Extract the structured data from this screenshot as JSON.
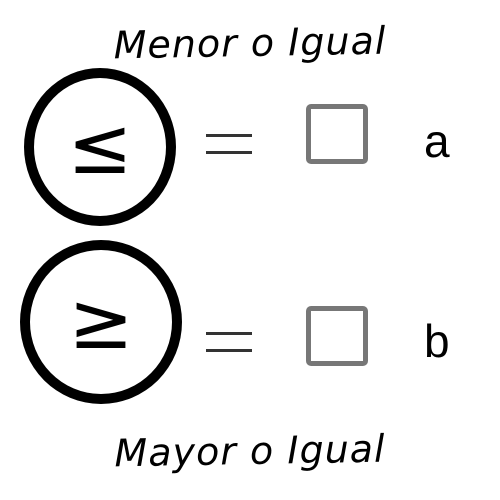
{
  "top_caption": "Menor o Igual",
  "bottom_caption": "Mayor o Igual",
  "rows": [
    {
      "symbol": "≤",
      "equals": "=",
      "letter": "a",
      "checked": false
    },
    {
      "symbol": "≥",
      "equals": "=",
      "letter": "b",
      "checked": false
    }
  ],
  "icons": {
    "checkbox": "empty-square-checkbox-icon",
    "circle": "circle-outline-icon"
  },
  "colors": {
    "background": "#ffffff",
    "ink": "#000000",
    "checkbox_border": "#777777"
  }
}
